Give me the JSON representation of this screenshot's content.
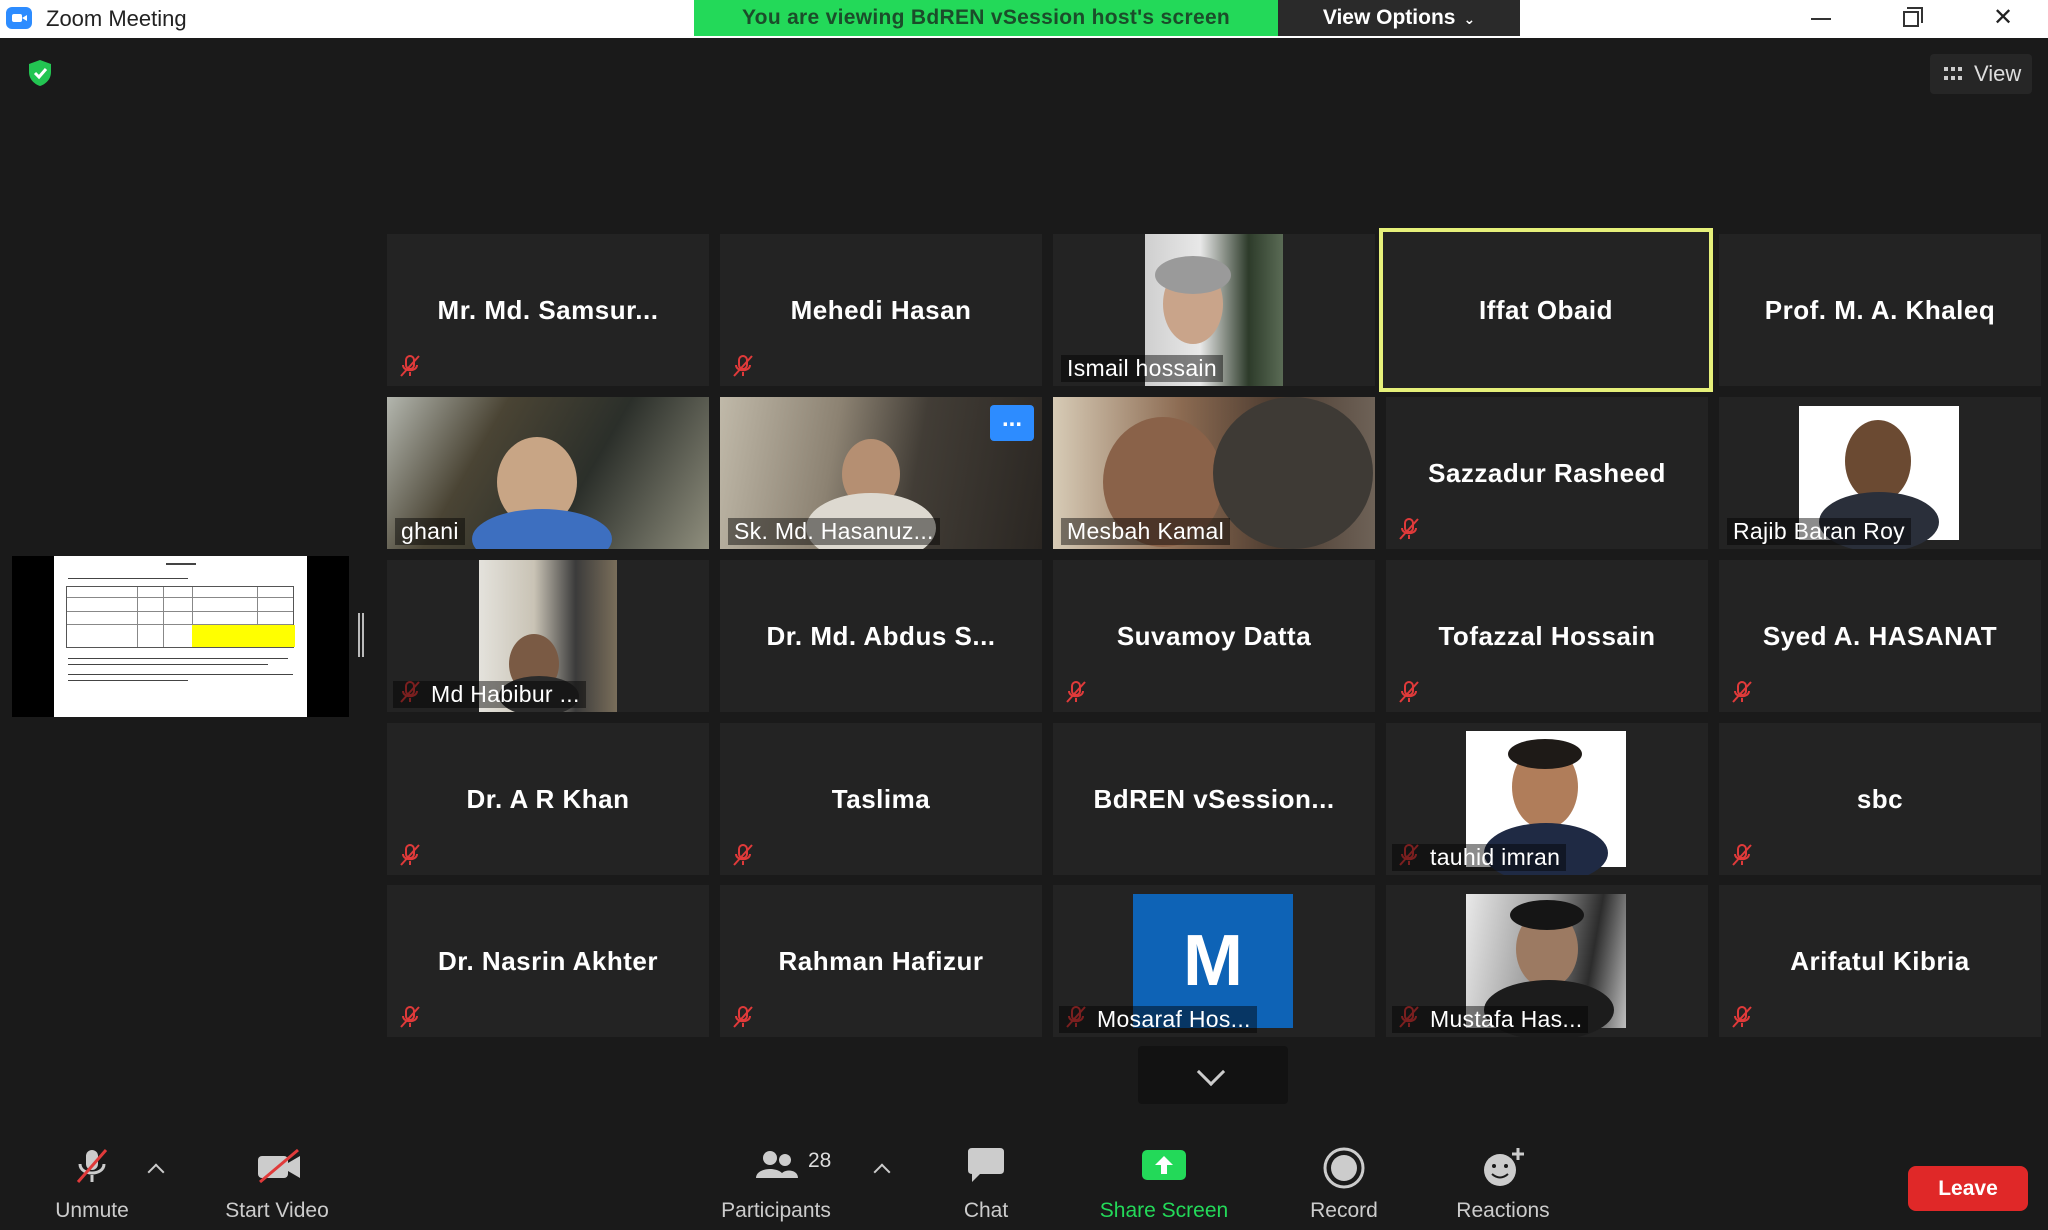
{
  "window": {
    "title": "Zoom Meeting"
  },
  "banner": {
    "text": "You are viewing BdREN vSession host's screen",
    "view_options": "View Options"
  },
  "view_button": {
    "label": "View"
  },
  "colors": {
    "accent": "#2d8cff",
    "banner_green": "#23d959",
    "active_border": "#e6f07a",
    "leave_red": "#e02828"
  },
  "participants": [
    {
      "name": "Mr. Md. Samsur...",
      "muted": true,
      "video": false
    },
    {
      "name": "Mehedi Hasan",
      "muted": true,
      "video": false
    },
    {
      "name": "Ismail hossain",
      "muted": false,
      "video": true
    },
    {
      "name": "Iffat Obaid",
      "muted": false,
      "video": false,
      "active_speaker": true
    },
    {
      "name": "Prof. M. A. Khaleq",
      "muted": false,
      "video": false
    },
    {
      "name": "ghani",
      "muted": false,
      "video": true
    },
    {
      "name": "Sk. Md. Hasanuz...",
      "muted": false,
      "video": true
    },
    {
      "name": "Mesbah Kamal",
      "muted": false,
      "video": true
    },
    {
      "name": "Sazzadur Rasheed",
      "muted": true,
      "video": false
    },
    {
      "name": "Rajib Baran Roy",
      "muted": false,
      "video": true
    },
    {
      "name": "Md Habibur ...",
      "muted": true,
      "video": true
    },
    {
      "name": "Dr. Md. Abdus S...",
      "muted": false,
      "video": false
    },
    {
      "name": "Suvamoy Datta",
      "muted": true,
      "video": false
    },
    {
      "name": "Tofazzal Hossain",
      "muted": true,
      "video": false
    },
    {
      "name": "Syed A. HASANAT",
      "muted": true,
      "video": false
    },
    {
      "name": "Dr. A R Khan",
      "muted": true,
      "video": false
    },
    {
      "name": "Taslima",
      "muted": true,
      "video": false
    },
    {
      "name": "BdREN  vSession...",
      "muted": false,
      "video": false
    },
    {
      "name": "tauhid imran",
      "muted": true,
      "video": true
    },
    {
      "name": "sbc",
      "muted": true,
      "video": false
    },
    {
      "name": "Dr. Nasrin Akhter",
      "muted": true,
      "video": false
    },
    {
      "name": "Rahman Hafizur",
      "muted": true,
      "video": false
    },
    {
      "name": "Mosaraf Hos...",
      "muted": true,
      "video": false,
      "avatar_letter": "M"
    },
    {
      "name": "Mustafa Has...",
      "muted": true,
      "video": true
    },
    {
      "name": "Arifatul Kibria",
      "muted": true,
      "video": false
    }
  ],
  "tile_menu": {
    "icon": "more-icon",
    "label": "..."
  },
  "toolbar": {
    "unmute": "Unmute",
    "start_video": "Start Video",
    "participants": "Participants",
    "participant_count": "28",
    "chat": "Chat",
    "share_screen": "Share Screen",
    "record": "Record",
    "reactions": "Reactions",
    "leave": "Leave"
  }
}
